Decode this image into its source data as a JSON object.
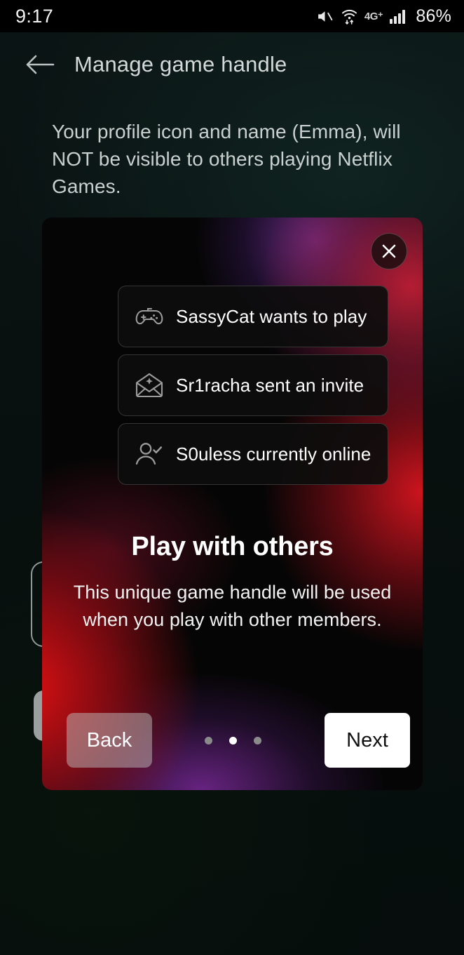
{
  "status_bar": {
    "time": "9:17",
    "battery": "86%",
    "network_label": "4G+",
    "icons": [
      "volume-mute-icon",
      "wifi-data-icon",
      "network-4g-icon",
      "signal-bars-icon"
    ]
  },
  "header": {
    "back_icon": "back-arrow-icon",
    "title": "Manage game handle"
  },
  "description": "Your profile icon and name (Emma), will NOT be visible to others playing Netflix Games.",
  "modal": {
    "close_icon": "close-x-icon",
    "cards": [
      {
        "icon": "gamepad-icon",
        "label": "SassyCat wants to play"
      },
      {
        "icon": "envelope-star-icon",
        "label": "Sr1racha sent an invite"
      },
      {
        "icon": "person-check-icon",
        "label": "S0uless currently online"
      }
    ],
    "headline": "Play with others",
    "subcopy": "This unique game handle will be used when you play with other members.",
    "back_label": "Back",
    "next_label": "Next",
    "pagination": {
      "total": 3,
      "active_index": 1
    }
  },
  "colors": {
    "page_background": "#08100f",
    "modal_red": "#e11014",
    "modal_purple": "#7e34a0",
    "next_button_bg": "#ffffff",
    "back_button_bg": "rgba(190,188,188,0.50)",
    "text_primary": "#ffffff",
    "text_muted": "#c9d1cf"
  }
}
